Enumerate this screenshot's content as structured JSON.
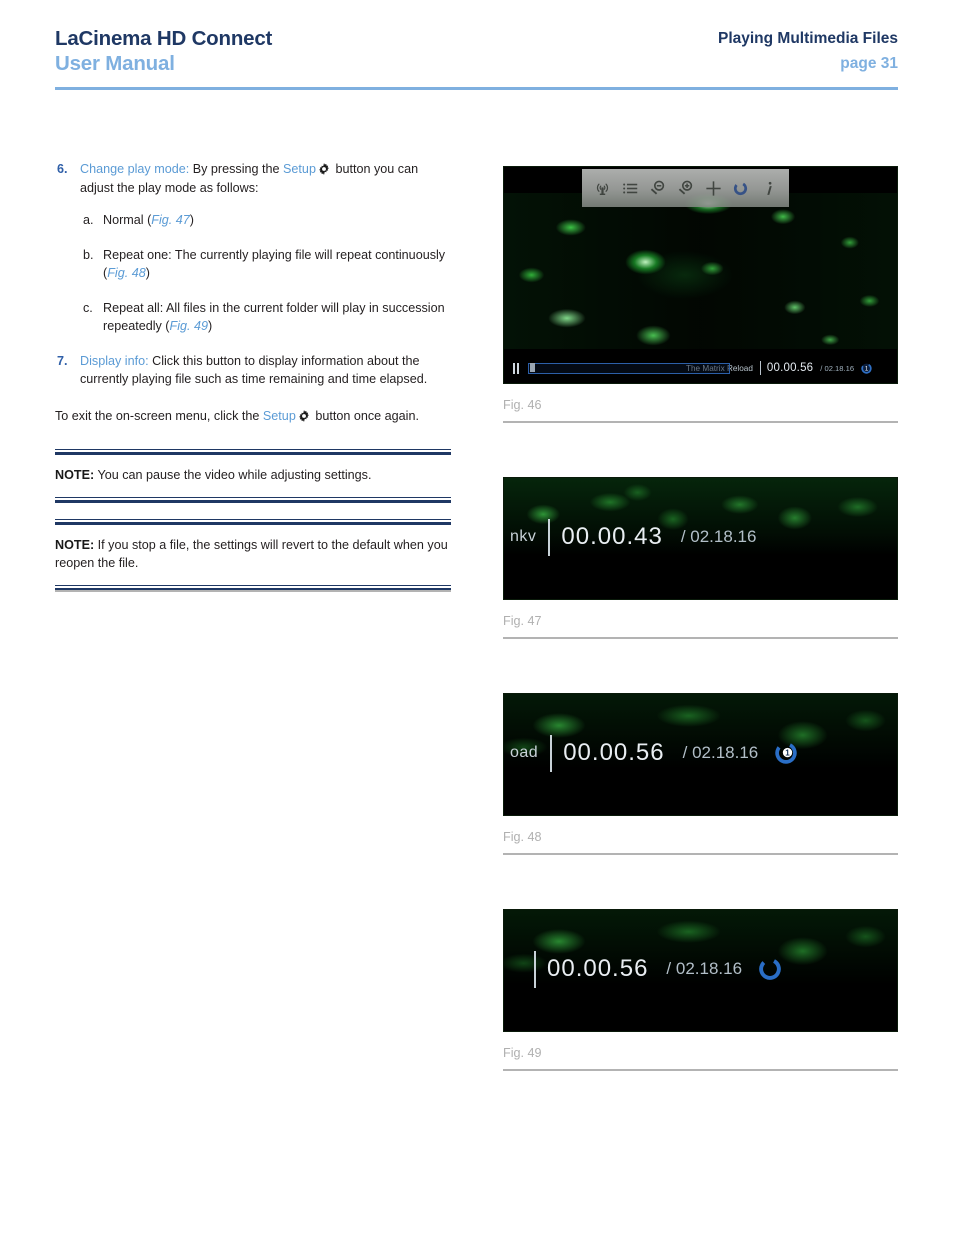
{
  "header": {
    "product_title": "LaCinema HD Connect",
    "document_type": "User Manual",
    "section": "Playing Multimedia Files",
    "page": "page 31",
    "rule_color": "#7fb0e0",
    "title_color": "#1f3864",
    "accent_color": "#7fb0e0"
  },
  "body": {
    "item6": {
      "number": "6.",
      "lead": "Change play mode:",
      "text_before_icon": " By pressing the ",
      "setup_word": "Setup",
      "icon": "gear-icon",
      "text_after_icon": " button you can adjust the play mode as follows:",
      "sub_items": [
        {
          "marker": "a.",
          "text_before_ref": "Normal (",
          "figref": "Fig. 47",
          "text_after_ref": ")"
        },
        {
          "marker": "b.",
          "text_before_ref": "Repeat one: The currently playing file will repeat continuously (",
          "figref": "Fig. 48",
          "text_after_ref": ")"
        },
        {
          "marker": "c.",
          "text_before_ref": "Repeat all: All files in the current folder will play in succession repeatedly (",
          "figref": "Fig. 49",
          "text_after_ref": ")"
        }
      ]
    },
    "item7": {
      "number": "7.",
      "lead": "Display info:",
      "text": " Click this button to display information about the currently playing file such as time remaining and time elapsed."
    },
    "exit_paragraph": {
      "text_before": "To exit the on-screen menu, click the ",
      "setup_word": "Setup",
      "icon": "gear-icon",
      "text_after": " button once again."
    },
    "notes": [
      {
        "label": "NOTE:",
        "text": " You can pause the video while adjusting settings."
      },
      {
        "label": "NOTE:",
        "text": " If you stop a file, the settings will revert to the default when you reopen the file."
      }
    ]
  },
  "figures": [
    {
      "caption": "Fig. 46",
      "kind": "player-full",
      "toolbar_icons": [
        "broadcast-icon",
        "list-icon",
        "zoom-out-icon",
        "zoom-in-icon",
        "crosshair-icon",
        "repeat-icon",
        "info-icon"
      ],
      "osd": {
        "transport_state": "pause-icon",
        "file_name": "The Matrix Reload",
        "current_time": "00.00.56",
        "total_time": "/ 02.18.16",
        "badge": "repeat-one-icon",
        "badge_label": "1"
      }
    },
    {
      "caption": "Fig. 47",
      "kind": "osd-strip",
      "osd": {
        "file_name": "nkv",
        "current_time": "00.00.43",
        "total_time": "/ 02.18.16",
        "badge": "none",
        "badge_label": ""
      }
    },
    {
      "caption": "Fig. 48",
      "kind": "osd-strip",
      "osd": {
        "file_name": "oad",
        "current_time": "00.00.56",
        "total_time": "/ 02.18.16",
        "badge": "repeat-one-icon",
        "badge_label": "1"
      }
    },
    {
      "caption": "Fig. 49",
      "kind": "osd-strip",
      "osd": {
        "file_name": "",
        "current_time": "00.00.56",
        "total_time": "/ 02.18.16",
        "badge": "repeat-all-icon",
        "badge_label": ""
      }
    }
  ]
}
